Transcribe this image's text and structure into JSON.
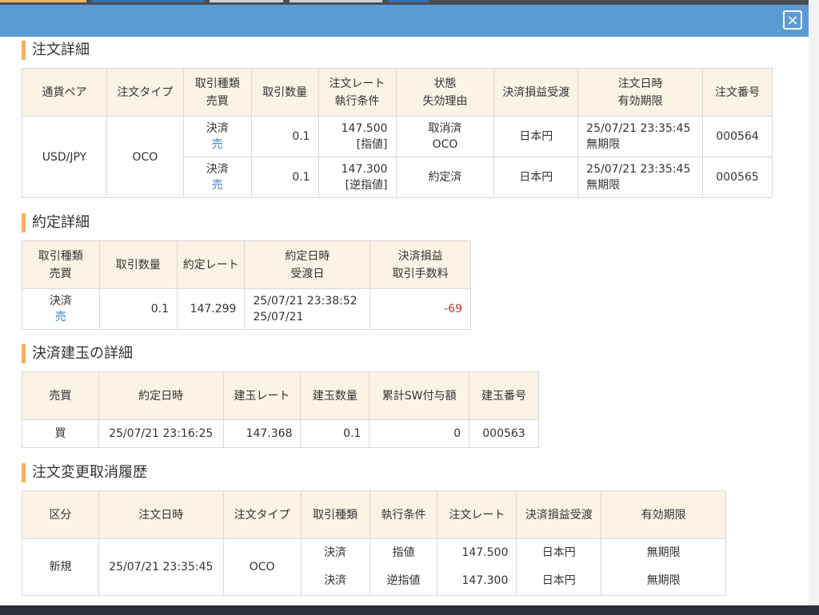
{
  "modal": {
    "close_icon": "×"
  },
  "order_detail": {
    "title": "注文詳細",
    "headers": [
      [
        "通貨ペア"
      ],
      [
        "注文タイプ"
      ],
      [
        "取引種類",
        "売買"
      ],
      [
        "取引数量"
      ],
      [
        "注文レート",
        "執行条件"
      ],
      [
        "状態",
        "失効理由"
      ],
      [
        "決済損益受渡"
      ],
      [
        "注文日時",
        "有効期限"
      ],
      [
        "注文番号"
      ]
    ],
    "pair": "USD/JPY",
    "order_type": "OCO",
    "rows": [
      {
        "kind": "決済",
        "side": "売",
        "qty": "0.1",
        "rate": "147.500",
        "cond": "[指値]",
        "status": "取消済",
        "reason": "OCO",
        "currency": "日本円",
        "datetime": "25/07/21 23:35:45",
        "expiry": "無期限",
        "order_no": "000564"
      },
      {
        "kind": "決済",
        "side": "売",
        "qty": "0.1",
        "rate": "147.300",
        "cond": "[逆指値]",
        "status": "約定済",
        "reason": "",
        "currency": "日本円",
        "datetime": "25/07/21 23:35:45",
        "expiry": "無期限",
        "order_no": "000565"
      }
    ]
  },
  "exec_detail": {
    "title": "約定詳細",
    "headers": [
      [
        "取引種類",
        "売買"
      ],
      [
        "取引数量"
      ],
      [
        "約定レート"
      ],
      [
        "約定日時",
        "受渡日"
      ],
      [
        "決済損益",
        "取引手数料"
      ]
    ],
    "row": {
      "kind": "決済",
      "side": "売",
      "qty": "0.1",
      "rate": "147.299",
      "datetime": "25/07/21 23:38:52",
      "delivery": "25/07/21",
      "pnl": "-69",
      "fee": ""
    }
  },
  "position_detail": {
    "title": "決済建玉の詳細",
    "headers": [
      "売買",
      "約定日時",
      "建玉レート",
      "建玉数量",
      "累計SW付与額",
      "建玉番号"
    ],
    "row": {
      "side": "買",
      "datetime": "25/07/21 23:16:25",
      "rate": "147.368",
      "qty": "0.1",
      "swap": "0",
      "position_no": "000563"
    }
  },
  "history": {
    "title": "注文変更取消履歴",
    "headers": [
      "区分",
      "注文日時",
      "注文タイプ",
      "取引種類",
      "執行条件",
      "注文レート",
      "決済損益受渡",
      "有効期限"
    ],
    "row": {
      "category": "新規",
      "datetime": "25/07/21 23:35:45",
      "order_type": "OCO",
      "kinds": [
        "決済",
        "決済"
      ],
      "conds": [
        "指値",
        "逆指値"
      ],
      "rates": [
        "147.500",
        "147.300"
      ],
      "currencies": [
        "日本円",
        "日本円"
      ],
      "expiries": [
        "無期限",
        "無期限"
      ]
    }
  },
  "colors": {
    "header_bar": "#5b9bd5",
    "section_accent": "#f2b25f",
    "table_header_bg": "#faf3e6",
    "sell": "#3a86c8",
    "buy": "#c0392b",
    "negative": "#c0392b"
  }
}
